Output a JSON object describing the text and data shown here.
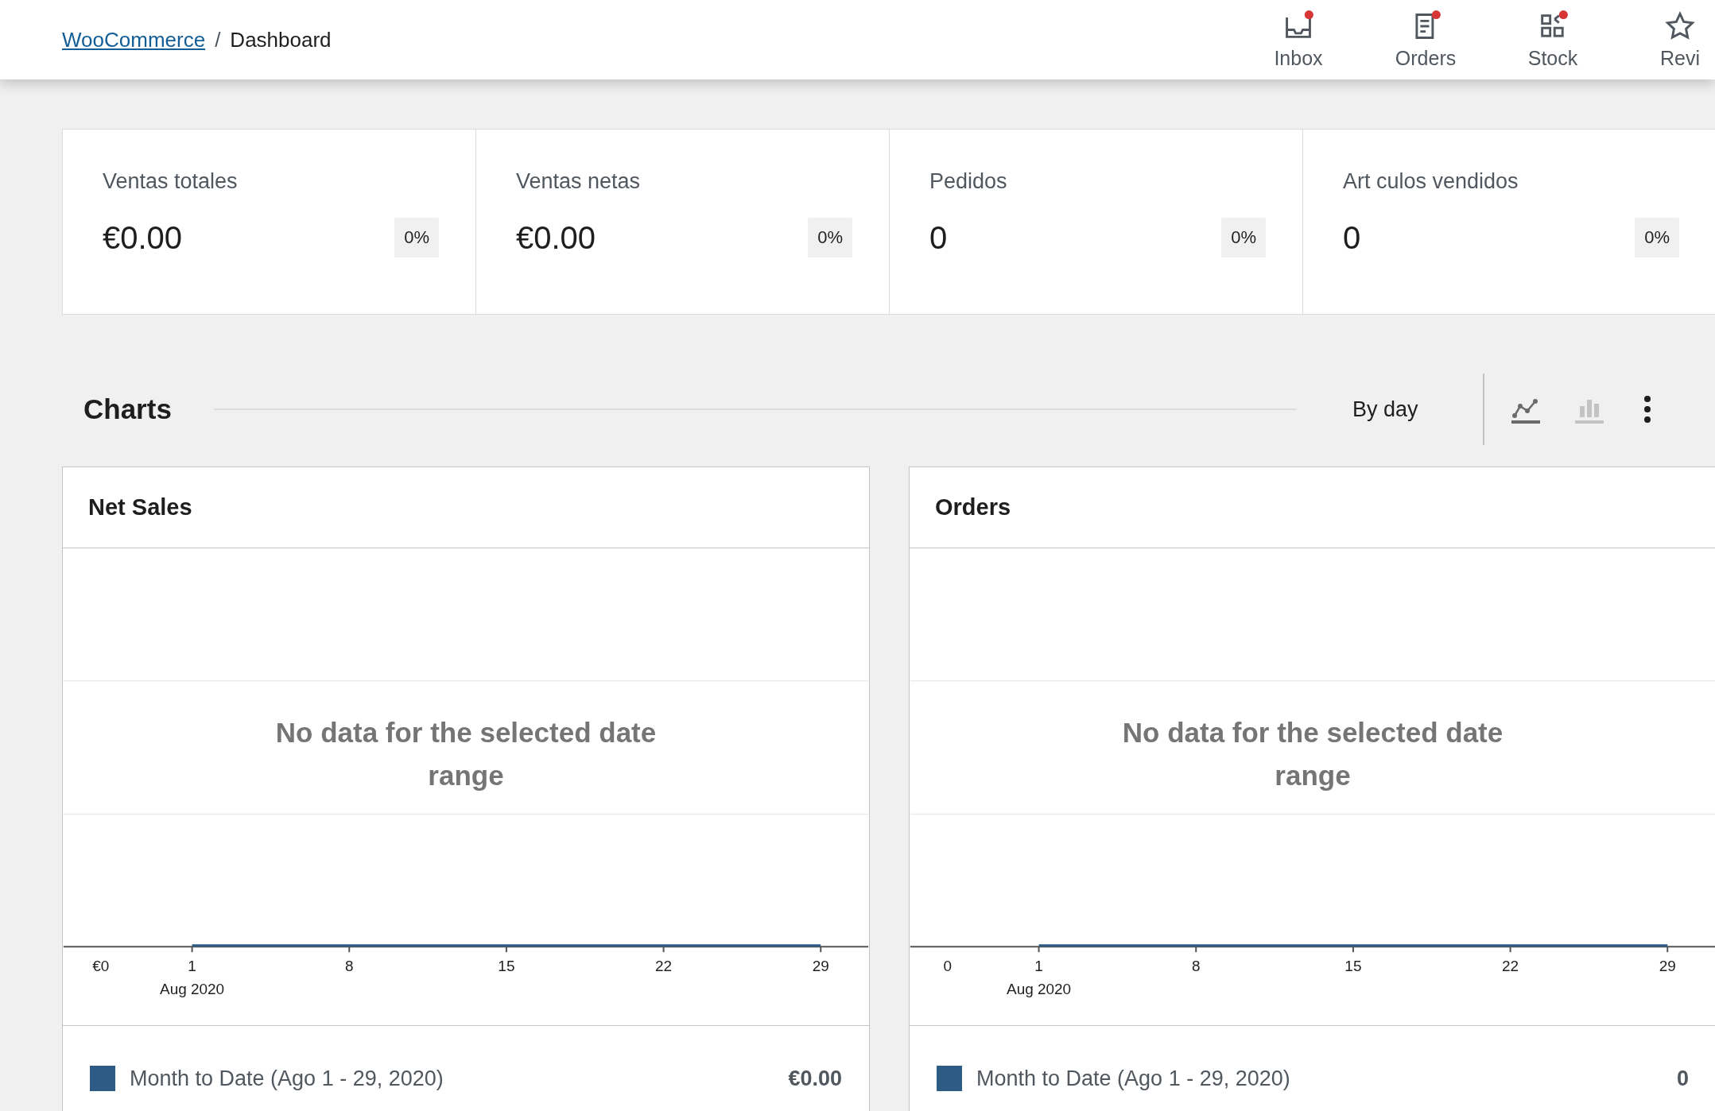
{
  "header": {
    "breadcrumb": [
      {
        "label": "WooCommerce",
        "kind": "link"
      },
      {
        "label": "Dashboard",
        "kind": "current"
      }
    ],
    "separator": "/",
    "activity": [
      {
        "label": "Inbox",
        "kind": "inbox",
        "unread": true
      },
      {
        "label": "Orders",
        "kind": "orders",
        "unread": true
      },
      {
        "label": "Stock",
        "kind": "stock",
        "unread": true
      },
      {
        "label": "Revi",
        "kind": "reviews",
        "unread": false
      }
    ]
  },
  "performance": {
    "stats": [
      {
        "label": "Ventas totales",
        "value": "€0.00",
        "delta": "0%"
      },
      {
        "label": "Ventas netas",
        "value": "€0.00",
        "delta": "0%"
      },
      {
        "label": "Pedidos",
        "value": "0",
        "delta": "0%"
      },
      {
        "label": "Art culos vendidos",
        "value": "0",
        "delta": "0%"
      }
    ]
  },
  "charts": {
    "title": "Charts",
    "interval": "By day",
    "chart_types": [
      {
        "kind": "line",
        "selected": true
      },
      {
        "kind": "bar",
        "selected": false
      }
    ],
    "panels": [
      {
        "title": "Net Sales",
        "empty_message": "No data for the selected date range",
        "y_label": "€0",
        "x_labels": [
          "1",
          "8",
          "15",
          "22",
          "29"
        ],
        "period_label": "Aug 2020",
        "legend": {
          "name": "Month to Date (Ago 1 - 29, 2020)",
          "color": "#2d5b85",
          "total": "€0.00"
        }
      },
      {
        "title": "Orders",
        "empty_message": "No data for the selected date range",
        "y_label": "0",
        "x_labels": [
          "1",
          "8",
          "15",
          "22",
          "29"
        ],
        "period_label": "Aug 2020",
        "legend": {
          "name": "Month to Date (Ago 1 - 29, 2020)",
          "color": "#2d5b85",
          "total": "0"
        }
      }
    ]
  }
}
